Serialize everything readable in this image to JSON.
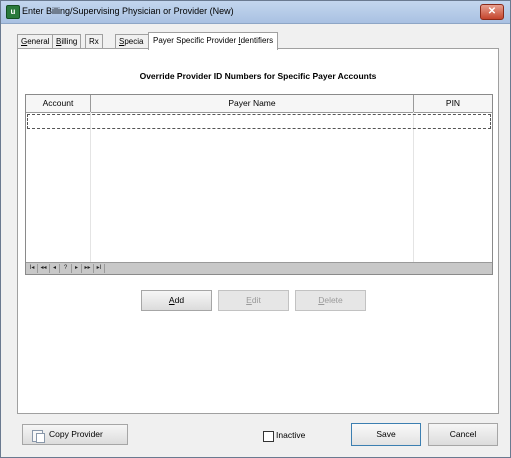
{
  "window": {
    "title": "Enter Billing/Supervising Physician or Provider  (New)",
    "close_glyph": "✕",
    "icon_letter": "u"
  },
  "tabs": [
    {
      "pre": "",
      "u": "G",
      "post": "eneral"
    },
    {
      "pre": "",
      "u": "B",
      "post": "illing"
    },
    {
      "pre": "Rx",
      "u": "",
      "post": ""
    },
    {
      "pre": "",
      "u": "S",
      "post": "pecia"
    },
    {
      "pre": "Payer Specific Provider ",
      "u": "I",
      "post": "dentifiers"
    }
  ],
  "panel": {
    "heading": "Override Provider ID Numbers for Specific Payer Accounts",
    "columns": [
      "Account",
      "Payer Name",
      "PIN"
    ],
    "nav_buttons": [
      "I◂",
      "◂◂",
      "◂",
      "?",
      "▸",
      "▸▸",
      "▸I"
    ],
    "add_label": {
      "u": "A",
      "rest": "dd"
    },
    "edit_label": {
      "u": "E",
      "rest": "dit"
    },
    "delete_label": {
      "u": "D",
      "rest": "elete"
    }
  },
  "footer": {
    "copy_provider": "Copy Provider",
    "inactive": "Inactive",
    "inactive_checked": false,
    "save": "Save",
    "cancel": "Cancel"
  }
}
